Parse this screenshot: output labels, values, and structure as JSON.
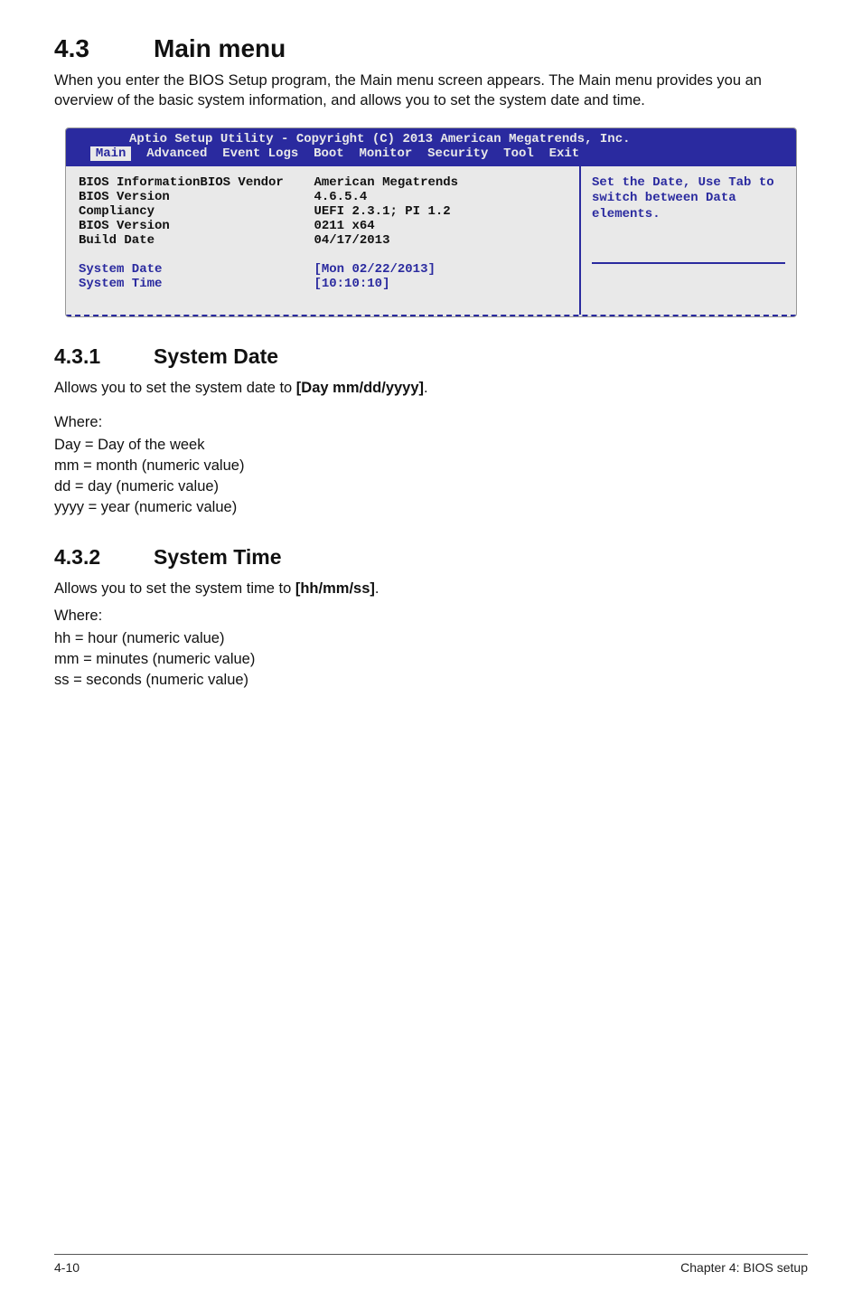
{
  "section": {
    "number": "4.3",
    "title": "Main menu"
  },
  "intro": "When you enter the BIOS Setup program, the Main menu screen appears. The Main menu provides you an overview of the basic system information, and allows you to set the system date and time.",
  "bios": {
    "header_line1": "Aptio Setup Utility - Copyright (C) 2013 American Megatrends, Inc.",
    "tabs": [
      "Main",
      "Advanced",
      "Event Logs",
      "Boot",
      "Monitor",
      "Security",
      "Tool",
      "Exit"
    ],
    "active_tab": "Main",
    "rows": [
      {
        "label": "BIOS InformationBIOS Vendor",
        "value": "American Megatrends"
      },
      {
        "label": "BIOS Version",
        "value": "4.6.5.4"
      },
      {
        "label": "Compliancy",
        "value": "UEFI 2.3.1; PI 1.2"
      },
      {
        "label": "BIOS Version",
        "value": "0211 x64"
      },
      {
        "label": "Build Date",
        "value": "04/17/2013"
      }
    ],
    "editable": [
      {
        "label": "System Date",
        "value": "[Mon 02/22/2013]"
      },
      {
        "label": "System Time",
        "value": "[10:10:10]"
      }
    ],
    "help": "Set the Date, Use Tab to switch between Data elements."
  },
  "sub1": {
    "number": "4.3.1",
    "title": "System Date",
    "desc_prefix": "Allows you to set the system date to ",
    "desc_bold": "[Day mm/dd/yyyy]",
    "desc_suffix": ".",
    "where": "Where:",
    "lines": [
      "Day = Day of the week",
      "mm = month (numeric value)",
      "dd = day (numeric value)",
      "yyyy = year (numeric value)"
    ]
  },
  "sub2": {
    "number": "4.3.2",
    "title": "System Time",
    "desc_prefix": "Allows you to set the system time to ",
    "desc_bold": "[hh/mm/ss]",
    "desc_suffix": ".",
    "where": "Where:",
    "lines": [
      "hh = hour (numeric value)",
      "mm = minutes (numeric value)",
      "ss = seconds (numeric value)"
    ]
  },
  "footer": {
    "left": "4-10",
    "right": "Chapter 4: BIOS setup"
  }
}
